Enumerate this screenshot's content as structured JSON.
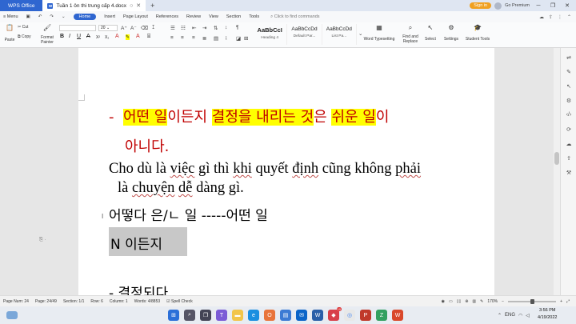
{
  "titlebar": {
    "app_tab": "WPS Office",
    "doc_tab": "Tuần 1 ôn thi trung cấp 4.docx",
    "doc_badge": "W",
    "sign_in": "Sign in",
    "go_premium": "Go Premium"
  },
  "menu": {
    "menu_label": "Menu",
    "tabs": [
      "Home",
      "Insert",
      "Page Layout",
      "References",
      "Review",
      "View",
      "Section",
      "Tools"
    ],
    "find": "Click to find commands"
  },
  "ribbon": {
    "paste": "Paste",
    "cut": "Cut",
    "copy": "Copy",
    "format_painter_1": "Format",
    "format_painter_2": "Painter",
    "font_size": "20",
    "styles": [
      {
        "preview": "AaBbCcI",
        "name": "Heading 4"
      },
      {
        "preview": "AaBbCcDd",
        "name": "Default Par..."
      },
      {
        "preview": "AaBbCcDd",
        "name": "List Pa..."
      }
    ],
    "word_typesetting": "Word Typesetting",
    "find_replace_1": "Find and",
    "find_replace_2": "Replace",
    "select": "Select",
    "settings": "Settings",
    "student_tools": "Student Tools"
  },
  "document": {
    "line1": {
      "dash": "-",
      "p1": "어떤 일",
      "p2": "이든지 ",
      "p3": "결정을 내리는 것",
      "p4": "은 ",
      "p5": "쉬운 일",
      "p6": "이"
    },
    "line2": "아니다.",
    "viet1": {
      "a": "Cho dù là ",
      "b": "việc",
      "c": " gì thì ",
      "d": "khi",
      "e": " quyết ",
      "f": "định",
      "g": " cũng không ",
      "h": "phải"
    },
    "viet2": {
      "a": "là ",
      "b": "chuyện",
      "c": " ",
      "d": "dễ",
      "e": " dàng gì."
    },
    "line3": "어떻다 은/ㄴ 일 -----어떤 일",
    "line4": "N 이든지",
    "line5": "-  결정되다"
  },
  "status": {
    "page_num": "Page Num: 24",
    "page": "Page: 24/49",
    "section": "Section: 1/1",
    "row": "Row: 6",
    "column": "Column: 1",
    "words": "Words: 4/8853",
    "spell": "Spell Check",
    "zoom": "170%"
  },
  "taskbar": {
    "lang": "ENG",
    "time": "3:56 PM",
    "date": "4/19/2022",
    "badge": "10"
  }
}
